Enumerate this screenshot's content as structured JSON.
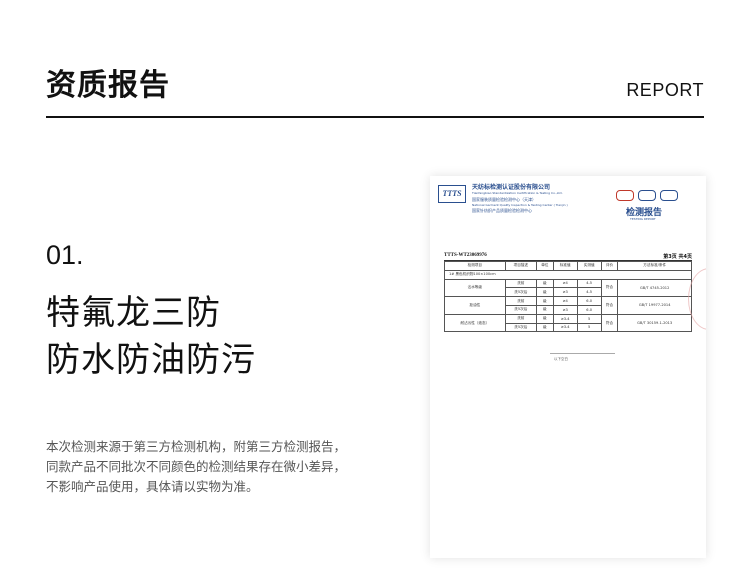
{
  "header": {
    "title": "资质报告",
    "report_label": "REPORT"
  },
  "feature": {
    "number": "01.",
    "headline_line1": "特氟龙三防",
    "headline_line2": "防水防油防污",
    "description_lines": [
      "本次检测来源于第三方检测机构，附第三方检测报告，",
      "同款产品不同批次不同颜色的检测结果存在微小差异，",
      "不影响产品使用，具体请以实物为准。"
    ]
  },
  "document": {
    "logo_text": "TTTS",
    "org_name": "天纺标检测认证股份有限公司",
    "org_name_en": "Tianfangbiao Standardization Certification & Testing Co.,Ltd.",
    "org_line2": "国家服装质量检验检测中心（天津）",
    "org_line2_en": "National Garment Quality Inspection & Testing Center ( Tianjin )",
    "org_line3": "国家针纺织产品质量检验检测中心",
    "heading": "检测报告",
    "heading_en": "TESTING REPORT",
    "report_no": "TTTS-WT23069976",
    "page_no": "第3页 共4页",
    "table_header": [
      "检测项目",
      "项目描述",
      "单位",
      "标准值",
      "实测值",
      "评价",
      "方法标准/条件"
    ],
    "sample_row": "1#  黑色机织物100×100cm",
    "rows": [
      {
        "item": "沾水等级",
        "desc": "洗前",
        "unit": "级",
        "std": "≥4",
        "val": "4-5",
        "eval": "符合",
        "method": "GB/T 4745-2012"
      },
      {
        "item": "",
        "desc": "洗5次后",
        "unit": "级",
        "std": "≥3",
        "val": "4-5",
        "eval": "",
        "method": ""
      },
      {
        "item": "拒油性",
        "desc": "洗前",
        "unit": "级",
        "std": "≥4",
        "val": "6.0",
        "eval": "符合",
        "method": "GB/T 19977-2014"
      },
      {
        "item": "",
        "desc": "洗5次后",
        "unit": "级",
        "std": "≥3",
        "val": "6.0",
        "eval": "",
        "method": ""
      },
      {
        "item": "耐沾污性（液态）",
        "desc": "洗前",
        "unit": "级",
        "std": "≥3-4",
        "val": "5",
        "eval": "符合",
        "method": "GB/T 30159.1-2013"
      },
      {
        "item": "",
        "desc": "洗5次后",
        "unit": "级",
        "std": "≥3-4",
        "val": "5",
        "eval": "",
        "method": ""
      }
    ],
    "footer": "以下空白"
  }
}
